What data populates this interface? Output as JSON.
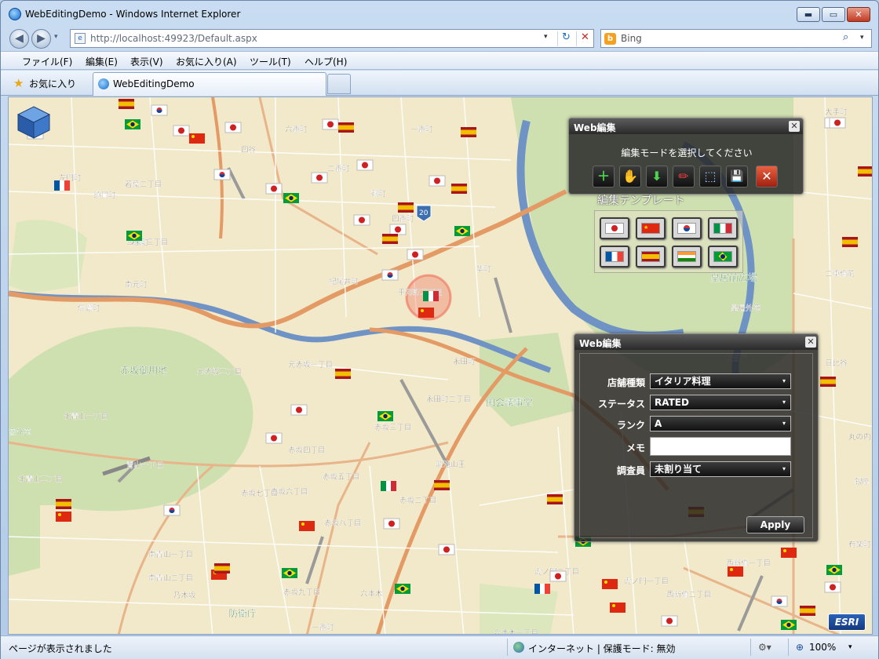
{
  "window": {
    "title": "WebEditingDemo - Windows Internet Explorer",
    "min": "▬",
    "max": "▭",
    "close": "✕"
  },
  "navbar": {
    "back": "◀",
    "forward": "▶",
    "dropdown": "▾",
    "url": "http://localhost:49923/Default.aspx",
    "refresh": "↻",
    "stop": "✕"
  },
  "search": {
    "engine_logo": "b",
    "placeholder": "Bing",
    "button": "⌕",
    "dropdown": "▾"
  },
  "menubar": {
    "items": [
      "ファイル(F)",
      "編集(E)",
      "表示(V)",
      "お気に入り(A)",
      "ツール(T)",
      "ヘルプ(H)"
    ]
  },
  "favorites": {
    "label": "お気に入り",
    "tab_title": "WebEditingDemo"
  },
  "status": {
    "message": "ページが表示されました",
    "zone": "インターネット | 保護モード: 無効",
    "zoom": "100%",
    "zoom_dd": "▾"
  },
  "map": {
    "labels": [
      "六番町",
      "四谷",
      "一番町",
      "麹町",
      "二番町",
      "四番町",
      "若葉二丁目",
      "若葉三丁目",
      "須賀町",
      "左門町",
      "信濃町",
      "南元町",
      "三栄町",
      "紀尾井町",
      "平河町二丁目",
      "隼町",
      "永田町",
      "赤坂御用地",
      "元赤坂二丁目",
      "元赤坂一丁目",
      "北青山一丁目",
      "青山一丁目",
      "北青山二丁目",
      "赤坂四丁目",
      "赤坂五丁目",
      "赤坂六丁目",
      "赤坂七丁目",
      "赤坂八丁目",
      "赤坂九丁目",
      "南青山一丁目",
      "南青山二丁目",
      "乃木坂",
      "防衛庁",
      "六本木",
      "赤坂二丁目",
      "赤坂三丁目",
      "国会議事堂",
      "永田町二丁目",
      "溜池山王",
      "宮外苑",
      "皇居前広場",
      "二重橋前",
      "皇居外苑",
      "桜田門",
      "日比谷",
      "西新橋一丁目",
      "西新橋二丁目",
      "虎ノ門一丁目",
      "虎ノ門二丁目",
      "六本木一丁目",
      "一番町",
      "大手町",
      "丸の内",
      "有楽町",
      "銀座"
    ],
    "route_shield": "20",
    "esri": "ESRI"
  },
  "edit_panel": {
    "title": "Web編集",
    "prompt": "編集モードを選択してください",
    "close": "✕",
    "tools": [
      "＋",
      "✋",
      "⬇",
      "✏",
      "⬚",
      "💾",
      "✕"
    ],
    "template_label": "編集テンプレート"
  },
  "template_flags": [
    "japan",
    "china",
    "korea",
    "italy",
    "france",
    "spain",
    "india",
    "brazil"
  ],
  "attr_panel": {
    "title": "Web編集",
    "close": "✕",
    "fields": [
      {
        "label": "店舗種類",
        "value": "イタリア料理",
        "type": "select"
      },
      {
        "label": "ステータス",
        "value": "RATED",
        "type": "select"
      },
      {
        "label": "ランク",
        "value": "A",
        "type": "select"
      },
      {
        "label": "メモ",
        "value": "",
        "type": "input"
      },
      {
        "label": "調査員",
        "value": "未割り当て",
        "type": "select"
      }
    ],
    "apply": "Apply",
    "dd": "▾"
  },
  "colors": {
    "accent": "#1468c8",
    "panel": "#262626",
    "map_bg": "#f1e9c9",
    "park": "#cfe0b0",
    "water": "#6f93c4"
  }
}
